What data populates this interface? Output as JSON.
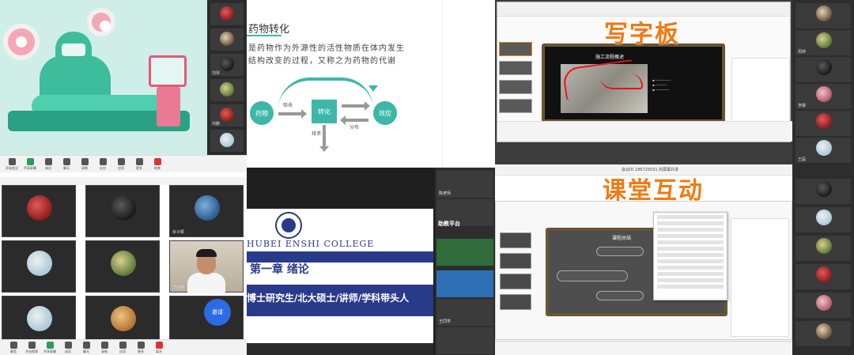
{
  "panel1": {
    "toolbar": [
      "开始会议",
      "共享屏幕",
      "成员",
      "聊天",
      "录制",
      "反应",
      "应用",
      "更多",
      "结束"
    ],
    "strip_names": [
      "",
      "",
      "刘琴",
      "",
      "鸿鹏",
      "",
      "王雪"
    ]
  },
  "panel2": {
    "title": "药物转化",
    "line1": "是药物作为外源性的活性物质在体内发生",
    "line2": "结构改变的过程，又称之为药物的代谢",
    "flow": {
      "drug": "药物",
      "transform": "转化",
      "effect": "效应",
      "absorb": "吸收",
      "distribute": "分布",
      "excrete": "排泄"
    }
  },
  "panel3": {
    "caption": "写字板",
    "slide_heading": "施工流程概述",
    "names": [
      "",
      "周婷",
      "",
      "李娜",
      "",
      "王磊"
    ]
  },
  "panel4": {
    "names": [
      "",
      "",
      "余子颖",
      "",
      "",
      "王子晗",
      "",
      "",
      ""
    ],
    "button_label": "邀请",
    "toolbar": [
      "静音",
      "开启视频",
      "共享屏幕",
      "成员",
      "聊天",
      "录制",
      "应用",
      "更多",
      "离开"
    ]
  },
  "panel5": {
    "college": "HUBEI ENSHI COLLEGE",
    "chapter": "第一章  绪论",
    "credentials": "博士研究生/北大硕士/讲师/学科带头人",
    "platform": "助教平台",
    "strip_labels": [
      "陈老师",
      "",
      "",
      "",
      "王同学",
      ""
    ]
  },
  "panel6": {
    "caption": "课堂互动",
    "head_text": "会议ID 186725031 的屏幕共享",
    "slide_title": "课程总结",
    "names": [
      "",
      "",
      "",
      "",
      "",
      ""
    ]
  }
}
